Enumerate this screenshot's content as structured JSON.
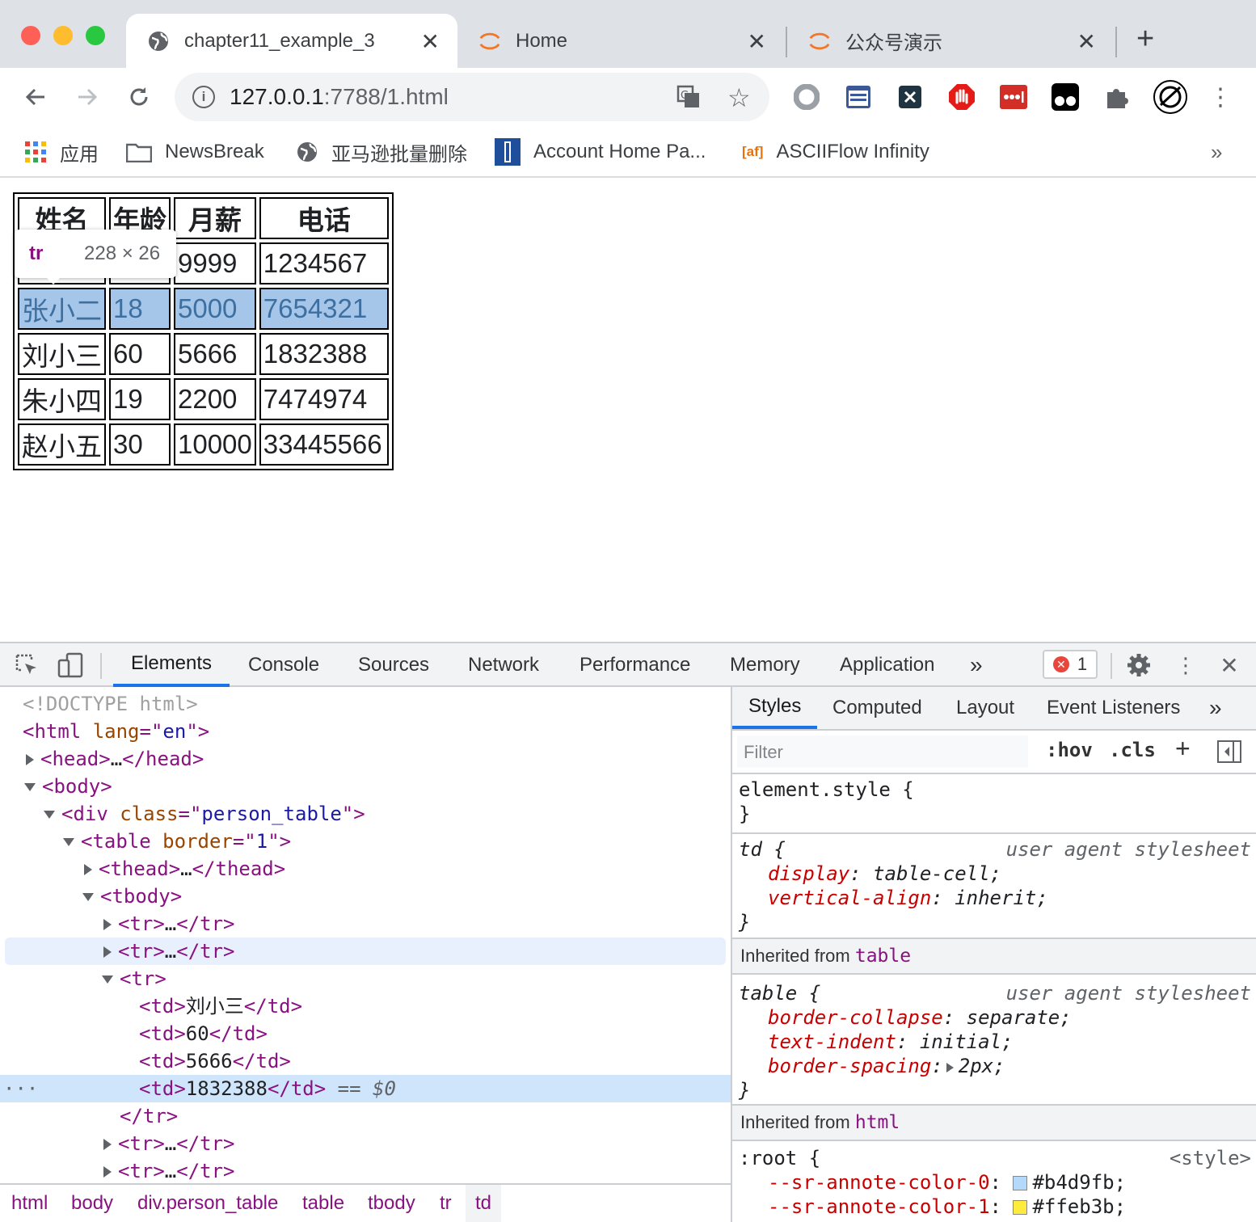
{
  "browser": {
    "tabs": [
      {
        "title": "chapter11_example_3",
        "active": true
      },
      {
        "title": "Home",
        "active": false
      },
      {
        "title": "公众号演示",
        "active": false
      }
    ],
    "url_host": "127.0.0.1",
    "url_rest": ":7788/1.html",
    "bookmarks": [
      "应用",
      "NewsBreak",
      "亚马逊批量删除",
      "Account Home Pa...",
      "ASCIIFlow Infinity"
    ],
    "bookmark_overflow": "»"
  },
  "page": {
    "table": {
      "headers": [
        "姓名",
        "年龄",
        "月薪",
        "电话"
      ],
      "rows": [
        [
          "",
          "",
          "9999",
          "1234567"
        ],
        [
          "张小二",
          "18",
          "5000",
          "7654321"
        ],
        [
          "刘小三",
          "60",
          "5666",
          "1832388"
        ],
        [
          "朱小四",
          "19",
          "2200",
          "7474974"
        ],
        [
          "赵小五",
          "30",
          "10000",
          "33445566"
        ]
      ]
    },
    "tooltip": {
      "tag": "tr",
      "dims": "228 × 26"
    }
  },
  "devtools": {
    "tabs": [
      "Elements",
      "Console",
      "Sources",
      "Network",
      "Performance",
      "Memory",
      "Application"
    ],
    "more": "»",
    "error_count": "1",
    "dom_lines": [
      "<!DOCTYPE html>",
      "<html lang=\"en\">",
      "<head>…</head>",
      "<body>",
      "<div class=\"person_table\">",
      "<table border=\"1\">",
      "<thead>…</thead>",
      "<tbody>",
      "<tr>…</tr>",
      "<tr>…</tr>",
      "<tr>",
      "刘小三",
      "60",
      "5666",
      "1832388",
      "</tr>",
      "<tr>…</tr>",
      "<tr>…</tr>"
    ],
    "selected_marker": "== $0",
    "breadcrumb": [
      "html",
      "body",
      "div.person_table",
      "table",
      "tbody",
      "tr",
      "td"
    ],
    "styles": {
      "tabs": [
        "Styles",
        "Computed",
        "Layout",
        "Event Listeners"
      ],
      "filter_placeholder": "Filter",
      "hov": ":hov",
      "cls": ".cls",
      "element_style": "element.style {",
      "ua": "user agent stylesheet",
      "td_rule": {
        "selector": "td",
        "props": [
          [
            "display",
            "table-cell"
          ],
          [
            "vertical-align",
            "inherit"
          ]
        ]
      },
      "inherited_table": "table",
      "table_rule": {
        "selector": "table",
        "props": [
          [
            "border-collapse",
            "separate"
          ],
          [
            "text-indent",
            "initial"
          ],
          [
            "border-spacing",
            "2px"
          ]
        ]
      },
      "inherited_html": "html",
      "inherited_label": "Inherited from",
      "root_rule": {
        "selector": ":root",
        "source": "<style>",
        "props": [
          [
            "--sr-annote-color-0",
            "#b4d9fb"
          ],
          [
            "--sr-annote-color-1",
            "#ffeb3b"
          ]
        ]
      }
    }
  }
}
